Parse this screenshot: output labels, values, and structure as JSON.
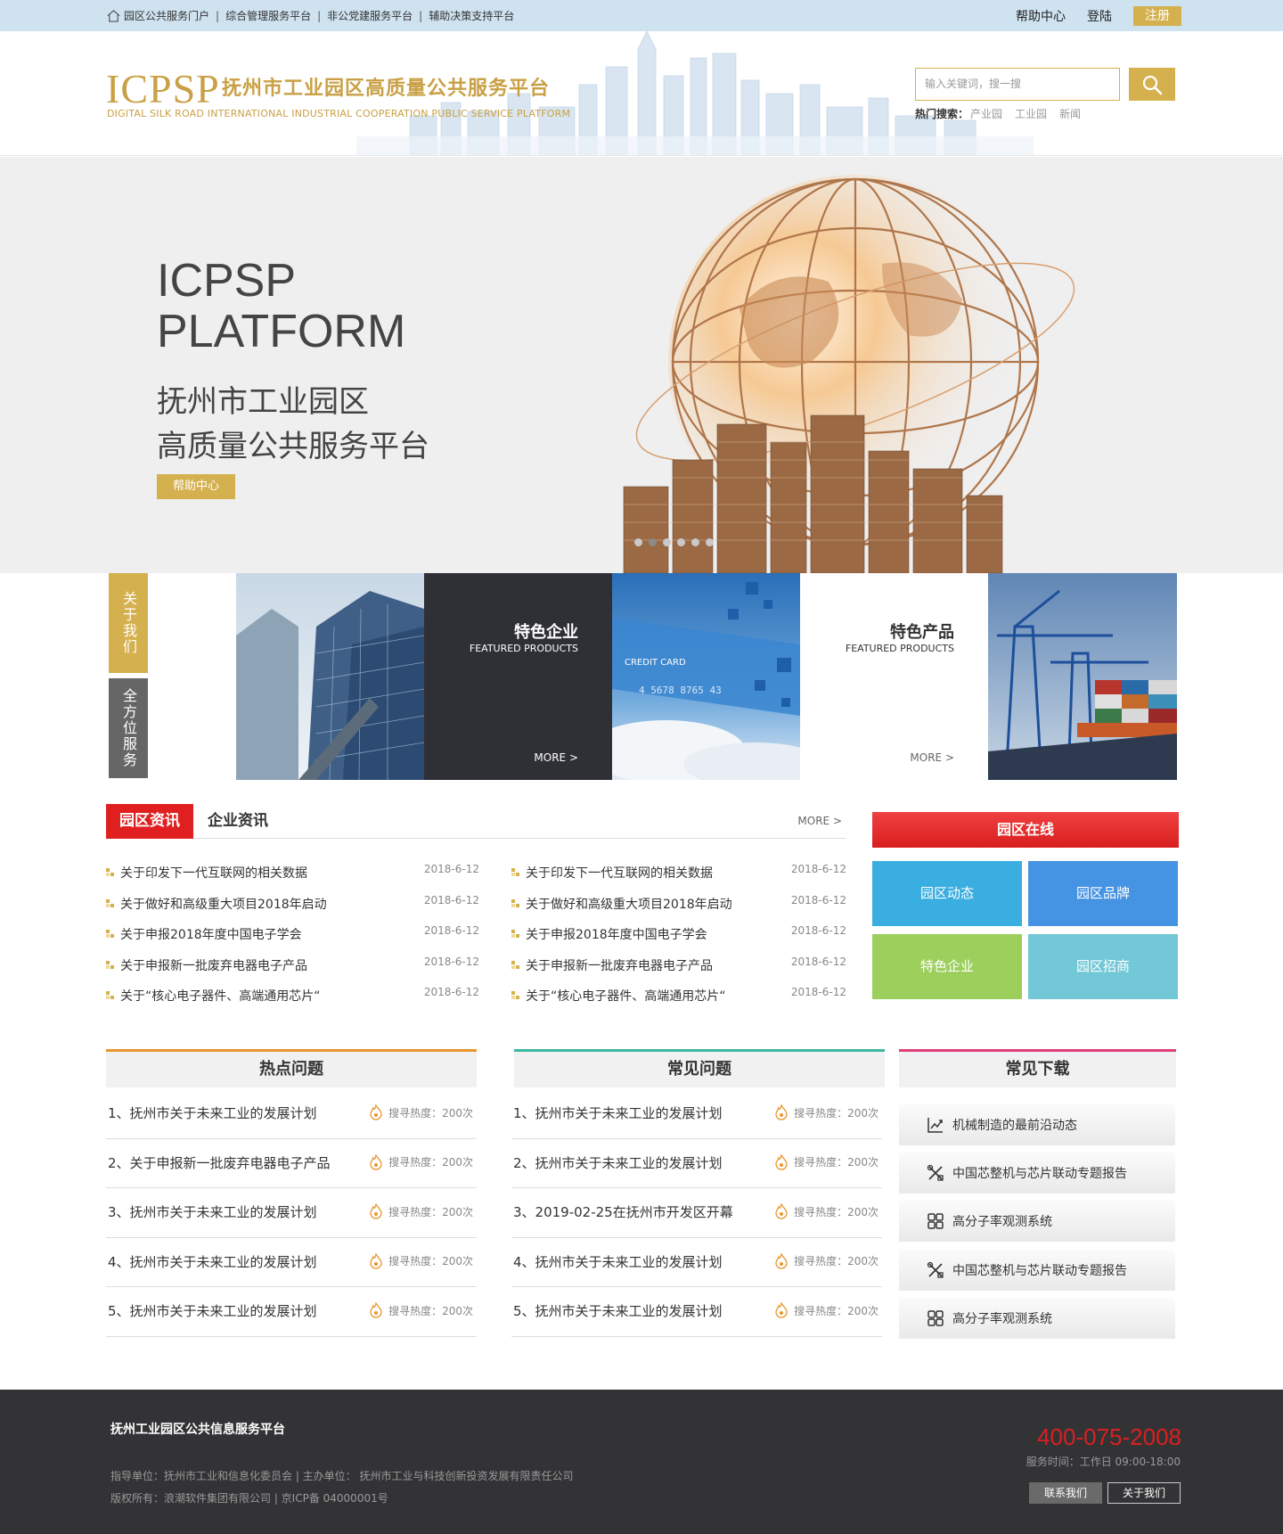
{
  "topbar": {
    "links": [
      "园区公共服务门户",
      "综合管理服务平台",
      "非公党建服务平台",
      "辅助决策支持平台"
    ],
    "help": "帮助中心",
    "login": "登陆",
    "register": "注册"
  },
  "header": {
    "logo": "ICPSP",
    "title": "抚州市工业园区高质量公共服务平台",
    "subtitle": "DIGITAL SILK ROAD INTERNATIONAL INDUSTRIAL COOPERATION PUBLIC SERVICE PLATFORM",
    "search_placeholder": "输入关键词，搜一搜",
    "hot_label": "热门搜索：",
    "hot_keywords": [
      "产业园",
      "工业园",
      "新闻"
    ]
  },
  "hero": {
    "en_line1": "ICPSP",
    "en_line2": "PLATFORM",
    "cn_line1": "抚州市工业园区",
    "cn_line2": "高质量公共服务平台",
    "button": "帮助中心"
  },
  "features": {
    "about": "关于我们",
    "service": "全方位服务",
    "tile1": {
      "title": "特色企业",
      "subtitle": "FEATURED PRODUCTS",
      "more": "MORE >"
    },
    "tile2": {
      "title": "特色产品",
      "subtitle": "FEATURED PRODUCTS",
      "more": "MORE >"
    },
    "card_text": "CREDIT CARD",
    "card_number": "4 5678 8765 43"
  },
  "news": {
    "tab_active": "园区资讯",
    "tab_other": "企业资讯",
    "more": "MORE >",
    "left": [
      {
        "title": "关于印发下一代互联网的相关数据",
        "date": "2018-6-12"
      },
      {
        "title": "关于做好和高级重大项目2018年启动",
        "date": "2018-6-12"
      },
      {
        "title": "关于申报2018年度中国电子学会",
        "date": "2018-6-12"
      },
      {
        "title": "关于申报新一批废弃电器电子产品",
        "date": "2018-6-12"
      },
      {
        "title": "关于“核心电子器件、高端通用芯片“",
        "date": "2018-6-12"
      }
    ],
    "right": [
      {
        "title": "关于印发下一代互联网的相关数据",
        "date": "2018-6-12"
      },
      {
        "title": "关于做好和高级重大项目2018年启动",
        "date": "2018-6-12"
      },
      {
        "title": "关于申报2018年度中国电子学会",
        "date": "2018-6-12"
      },
      {
        "title": "关于申报新一批废弃电器电子产品",
        "date": "2018-6-12"
      },
      {
        "title": "关于“核心电子器件、高端通用芯片“",
        "date": "2018-6-12"
      }
    ]
  },
  "online": {
    "title": "园区在线",
    "tiles": [
      "园区动态",
      "园区品牌",
      "特色企业",
      "园区招商"
    ],
    "colors": [
      "#3aaee0",
      "#4593e3",
      "#9ccf5c",
      "#72c8d6"
    ]
  },
  "hot_questions": {
    "title": "热点问题",
    "accent": "#e8962c",
    "items": [
      {
        "text": "1、抚州市关于未来工业的发展计划",
        "heat": "搜寻热度：200次"
      },
      {
        "text": "2、关于申报新一批废弃电器电子产品",
        "heat": "搜寻热度：200次"
      },
      {
        "text": "3、抚州市关于未来工业的发展计划",
        "heat": "搜寻热度：200次"
      },
      {
        "text": "4、抚州市关于未来工业的发展计划",
        "heat": "搜寻热度：200次"
      },
      {
        "text": "5、抚州市关于未来工业的发展计划",
        "heat": "搜寻热度：200次"
      }
    ]
  },
  "faq": {
    "title": "常见问题",
    "accent": "#3bb8a0",
    "items": [
      {
        "text": "1、抚州市关于未来工业的发展计划",
        "heat": "搜寻热度：200次"
      },
      {
        "text": "2、抚州市关于未来工业的发展计划",
        "heat": "搜寻热度：200次"
      },
      {
        "text": "3、2019-02-25在抚州市开发区开幕",
        "heat": "搜寻热度：200次"
      },
      {
        "text": "4、抚州市关于未来工业的发展计划",
        "heat": "搜寻热度：200次"
      },
      {
        "text": "5、抚州市关于未来工业的发展计划",
        "heat": "搜寻热度：200次"
      }
    ]
  },
  "downloads": {
    "title": "常见下载",
    "accent": "#e0407a",
    "items": [
      {
        "text": "机械制造的最前沿动态",
        "icon": "chart-icon"
      },
      {
        "text": "中国芯整机与芯片联动专题报告",
        "icon": "tools-icon"
      },
      {
        "text": "高分子率观测系统",
        "icon": "grid-icon"
      },
      {
        "text": "中国芯整机与芯片联动专题报告",
        "icon": "tools-icon"
      },
      {
        "text": "高分子率观测系统",
        "icon": "grid-icon"
      }
    ]
  },
  "footer": {
    "title": "抚州工业园区公共信息服务平台",
    "line1": "指导单位：抚州市工业和信息化委员会 | 主办单位： 抚州市工业与科技创新投资发展有限责任公司",
    "line2": "版权所有：浪潮软件集团有限公司 | 京ICP备 04000001号",
    "phone": "400-075-2008",
    "hours": "服务时间：工作日  09:00-18:00",
    "contact": "联系我们",
    "about": "关于我们"
  }
}
